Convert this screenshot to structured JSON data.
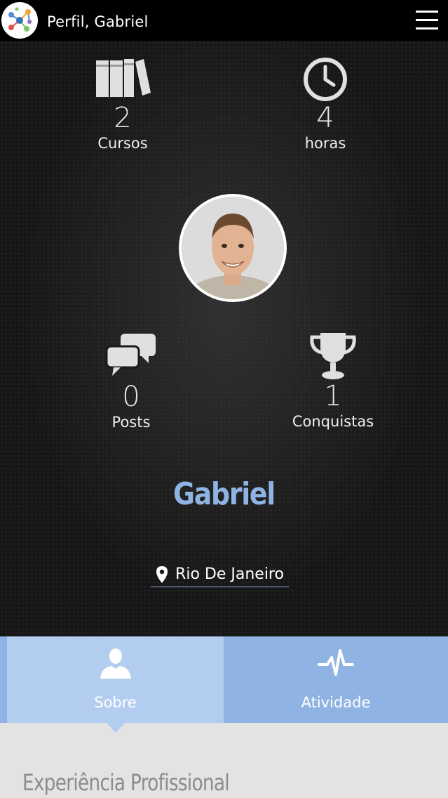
{
  "header": {
    "title": "Perfil, Gabriel",
    "logo_icon": "network-nodes-logo",
    "menu_icon": "hamburger-menu-icon"
  },
  "stats": {
    "courses": {
      "value": "2",
      "label": "Cursos",
      "icon": "books-icon"
    },
    "hours": {
      "value": "4",
      "label": "horas",
      "icon": "clock-icon"
    },
    "posts": {
      "value": "0",
      "label": "Posts",
      "icon": "chat-bubbles-icon"
    },
    "achievements": {
      "value": "1",
      "label": "Conquistas",
      "icon": "trophy-icon"
    }
  },
  "profile": {
    "name": "Gabriel",
    "location": "Rio De Janeiro",
    "location_icon": "map-pin-icon"
  },
  "tabs": [
    {
      "label": "Sobre",
      "icon": "user-icon",
      "active": true
    },
    {
      "label": "Atividade",
      "icon": "pulse-icon",
      "active": false
    }
  ],
  "content": {
    "section_title": "Experiência Profissional"
  },
  "colors": {
    "accent": "#8fb3e3",
    "tab_active": "#b2cdf0",
    "content_bg": "#e3e3e3"
  }
}
